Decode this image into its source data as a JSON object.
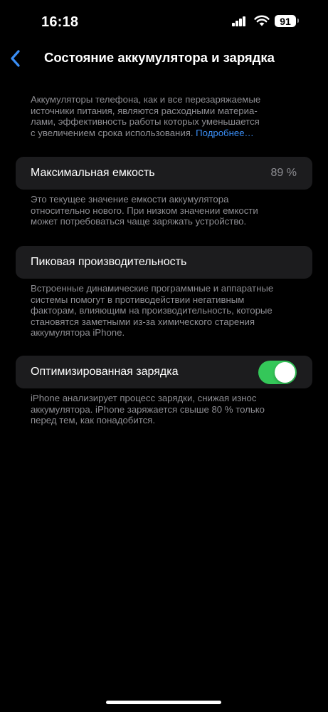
{
  "status_bar": {
    "time": "16:18",
    "battery_level": "91",
    "icons": [
      "signal-icon",
      "wifi-icon",
      "battery-icon"
    ]
  },
  "nav": {
    "back_icon": "chevron-left-icon",
    "title": "Состояние аккумулятора и зарядка"
  },
  "intro": {
    "line1": "Аккумуляторы телефона, как и все перезаряжаемые",
    "line2": "источники питания, являются расходными материа-",
    "line3": "лами, эффективность работы которых уменьшается",
    "line4": "с увеличением срока использования.",
    "link": "Подробнее…"
  },
  "max_capacity": {
    "label": "Максимальная емкость",
    "value": "89 %",
    "note": {
      "line1": "Это текущее значение емкости аккумулятора",
      "line2": "относительно нового. При низком значении емкости",
      "line3": "может потребоваться чаще заряжать устройство."
    }
  },
  "peak_performance": {
    "label": "Пиковая производительность",
    "note": {
      "line1": "Встроенные динамические программные и аппаратные",
      "line2": "системы помогут в противодействии негативным",
      "line3": "факторам, влияющим на производительность, которые",
      "line4": "становятся заметными из-за химического старения",
      "line5": "аккумулятора iPhone."
    }
  },
  "optimized_charging": {
    "label": "Оптимизированная зарядка",
    "enabled": true,
    "note": {
      "line1": "iPhone анализирует процесс зарядки, снижая износ",
      "line2": "аккумулятора. iPhone заряжается свыше 80 % только",
      "line3": "перед тем, как понадобится."
    }
  },
  "colors": {
    "background": "#000000",
    "group_background": "#1c1c1e",
    "secondary_text": "#8e8e93",
    "link": "#3a8ef6",
    "toggle_on": "#34c759"
  }
}
